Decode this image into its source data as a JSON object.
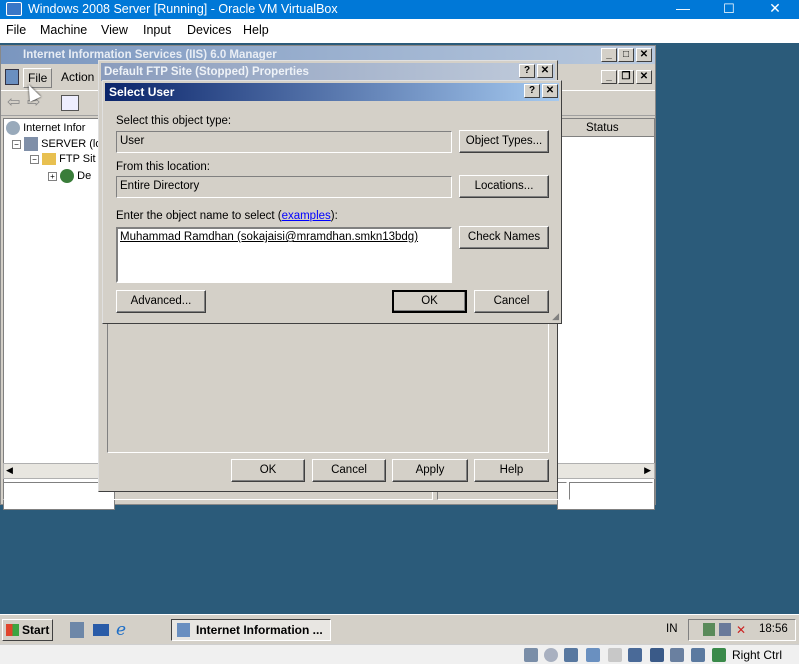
{
  "host": {
    "title": "Windows 2008 Server [Running] - Oracle VM VirtualBox",
    "minimize": "—",
    "maximize": "☐",
    "close": "✕",
    "menu": [
      "File",
      "Machine",
      "View",
      "Input",
      "Devices",
      "Help"
    ],
    "status_right_ctrl": "Right Ctrl"
  },
  "iis": {
    "title": "Internet Information Services (IIS) 6.0 Manager",
    "menu": [
      "File",
      "Action"
    ],
    "tree": [
      "Internet Infor",
      "SERVER (lo",
      "FTP Sit",
      "De"
    ],
    "column_status": "Status"
  },
  "props": {
    "title": "Default FTP Site (Stopped) Properties",
    "buttons": {
      "ok": "OK",
      "cancel": "Cancel",
      "apply": "Apply",
      "help": "Help"
    }
  },
  "select_user": {
    "title": "Select User",
    "object_type_label": "Select this object type:",
    "object_type_value": "User",
    "object_types_button": "Object Types...",
    "location_label": "From this location:",
    "location_value": "Entire Directory",
    "locations_button": "Locations...",
    "enter_label_prefix": "Enter the object name to select (",
    "examples_link": "examples",
    "enter_label_suffix": "):",
    "object_name_value": "Muhammad Ramdhan (sokajaisi@mramdhan.smkn13bdg)",
    "check_names_button": "Check Names",
    "advanced_button": "Advanced...",
    "ok_button": "OK",
    "cancel_button": "Cancel"
  },
  "taskbar": {
    "start": "Start",
    "task_iis": "Internet Information ...",
    "lang": "IN",
    "clock": "18:56"
  }
}
